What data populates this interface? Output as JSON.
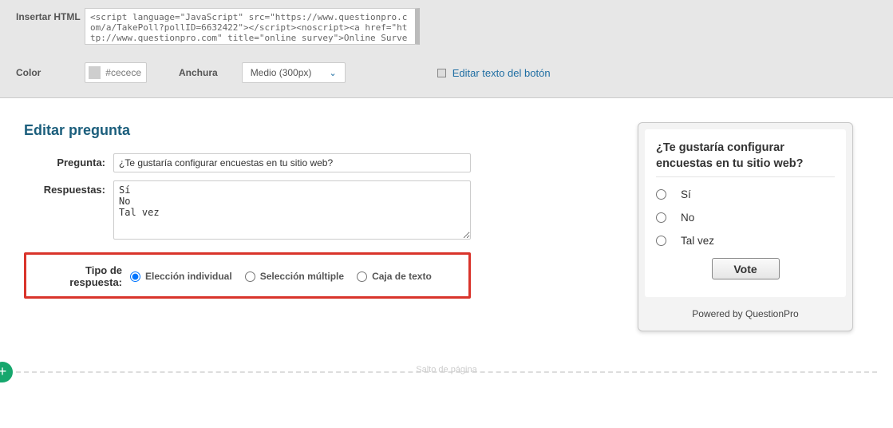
{
  "top": {
    "html_label": "Insertar HTML",
    "html_code": "<script language=\"JavaScript\" src=\"https://www.questionpro.com/a/TakePoll?pollID=6632422\"></script><noscript><a href=\"http://www.questionpro.com\" title=\"online survey\">Online Survey</a></noscript>",
    "color_label": "Color",
    "color_value": "#cecece",
    "width_label": "Anchura",
    "width_value": "Medio (300px)",
    "edit_button_text": "Editar texto del botón"
  },
  "edit": {
    "title": "Editar pregunta",
    "question_label": "Pregunta:",
    "question_value": "¿Te gustaría configurar encuestas en tu sitio web?",
    "answers_label": "Respuestas:",
    "answers_value": "Sí\nNo\nTal vez",
    "type_label": "Tipo de respuesta:",
    "type_opts": {
      "single": "Elección individual",
      "multi": "Selección múltiple",
      "text": "Caja de texto"
    }
  },
  "preview": {
    "question": "¿Te gustaría configurar encuestas en tu sitio web?",
    "options": {
      "a": "Sí",
      "b": "No",
      "c": "Tal vez"
    },
    "vote": "Vote",
    "powered": "Powered by QuestionPro"
  },
  "break_label": "Salto de página"
}
